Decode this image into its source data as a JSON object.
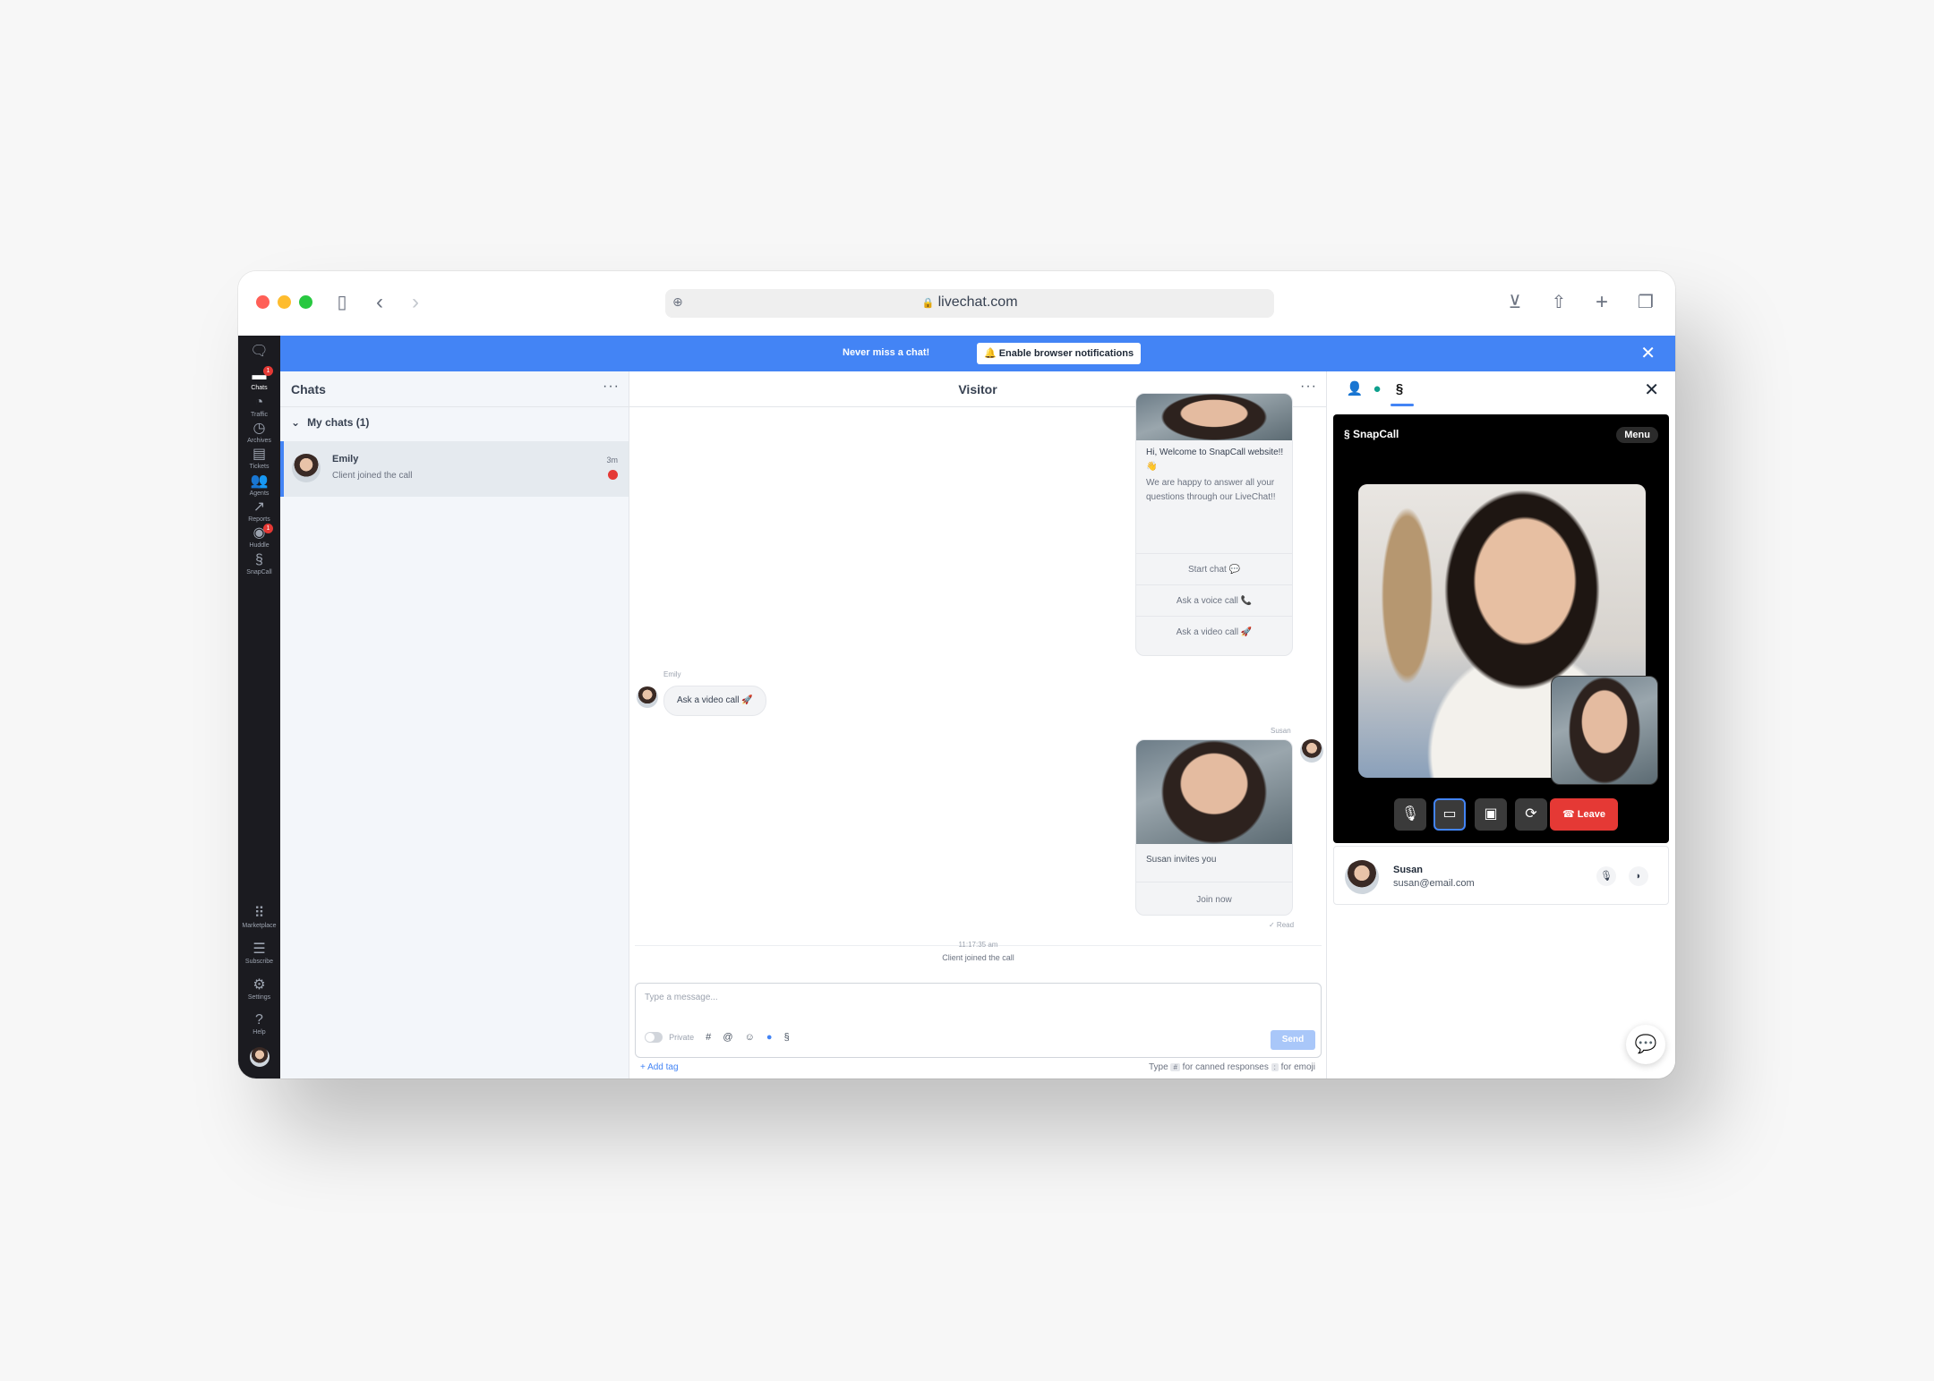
{
  "browser": {
    "url": "livechat.com",
    "traffic_colors": [
      "#ff5f57",
      "#febc2e",
      "#28c840"
    ]
  },
  "banner": {
    "message": "Never miss a chat!",
    "button_label": "Enable browser notifications",
    "color": "#4384f5"
  },
  "nav": {
    "items": [
      {
        "label": "Chats",
        "icon": "chat-icon",
        "badge": "1"
      },
      {
        "label": "Traffic",
        "icon": "traffic-icon"
      },
      {
        "label": "Archives",
        "icon": "archives-icon"
      },
      {
        "label": "Tickets",
        "icon": "tickets-icon"
      },
      {
        "label": "Agents",
        "icon": "agents-icon"
      },
      {
        "label": "Reports",
        "icon": "reports-icon"
      },
      {
        "label": "Huddle",
        "icon": "huddle-icon",
        "badge": "1"
      },
      {
        "label": "SnapCall",
        "icon": "snapcall-icon"
      }
    ],
    "bottom_items": [
      {
        "label": "Marketplace",
        "icon": "grid-icon"
      },
      {
        "label": "Subscribe",
        "icon": "subscribe-icon"
      },
      {
        "label": "Settings",
        "icon": "gear-icon"
      },
      {
        "label": "Help",
        "icon": "help-icon"
      }
    ]
  },
  "chats_panel": {
    "title": "Chats",
    "section": "My chats (1)",
    "items": [
      {
        "name": "Emily",
        "preview": "Client joined the call",
        "time": "3m"
      }
    ]
  },
  "chat": {
    "title": "Visitor",
    "welcome_card": {
      "greeting": "Hi, Welcome to SnapCall website!! 👋",
      "body": "We are happy to answer all your questions through our LiveChat!!",
      "options": [
        "Start chat 💬",
        "Ask a voice call 📞",
        "Ask a video call 🚀"
      ]
    },
    "visitor_message": {
      "sender": "Emily",
      "text": "Ask a video call 🚀"
    },
    "agent_message": {
      "sender": "Susan",
      "text": "Susan invites you",
      "action": "Join now",
      "status": "✓ Read"
    },
    "system_event": {
      "time": "11:17:35 am",
      "text": "Client joined the call"
    },
    "composer": {
      "placeholder": "Type a message...",
      "private_label": "Private",
      "send_label": "Send",
      "add_tag": "+ Add tag",
      "hint_prefix": "Type",
      "hint_key1": "#",
      "hint_mid": "for canned responses",
      "hint_key2": ":",
      "hint_suffix": "for emoji"
    }
  },
  "snapcall": {
    "brand": "SnapCall",
    "menu_label": "Menu",
    "leave_label": "Leave",
    "participant": {
      "name": "Susan",
      "email": "susan@email.com"
    }
  }
}
